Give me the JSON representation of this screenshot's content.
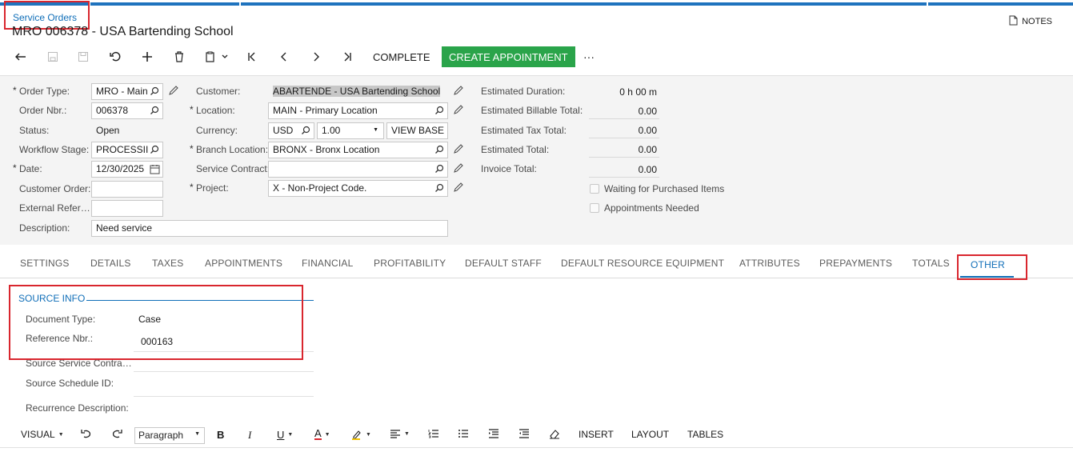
{
  "breadcrumb": "Service Orders",
  "title": "MRO 006378 - USA Bartending School",
  "notes_label": "NOTES",
  "toolbar": {
    "complete_label": "COMPLETE",
    "create_appointment_label": "CREATE APPOINTMENT",
    "more_label": "···"
  },
  "form": {
    "col1": {
      "order_type_label": "Order Type:",
      "order_type_value": "MRO - Main",
      "order_nbr_label": "Order Nbr.:",
      "order_nbr_value": "006378",
      "status_label": "Status:",
      "status_value": "Open",
      "workflow_stage_label": "Workflow Stage:",
      "workflow_stage_value": "PROCESSII",
      "date_label": "Date:",
      "date_value": "12/30/2025",
      "customer_order_label": "Customer Order:",
      "customer_order_value": "",
      "external_ref_label": "External Refer…",
      "external_ref_value": "",
      "description_label": "Description:",
      "description_value": "Need service"
    },
    "col2": {
      "customer_label": "Customer:",
      "customer_value": "ABARTENDE - USA Bartending School",
      "location_label": "Location:",
      "location_value": "MAIN - Primary Location",
      "currency_label": "Currency:",
      "currency_value": "USD",
      "rate_value": "1.00",
      "view_base_label": "VIEW BASE",
      "branch_location_label": "Branch Location:",
      "branch_location_value": "BRONX - Bronx Location",
      "service_contract_label": "Service Contract:",
      "service_contract_value": "",
      "project_label": "Project:",
      "project_value": "X - Non-Project Code."
    },
    "col3": {
      "est_duration_label": "Estimated Duration:",
      "est_duration_value": "0 h 00 m",
      "est_billable_label": "Estimated Billable Total:",
      "est_billable_value": "0.00",
      "est_tax_label": "Estimated Tax Total:",
      "est_tax_value": "0.00",
      "est_total_label": "Estimated Total:",
      "est_total_value": "0.00",
      "invoice_total_label": "Invoice Total:",
      "invoice_total_value": "0.00",
      "waiting_label": "Waiting for Purchased Items",
      "appointments_needed_label": "Appointments Needed"
    }
  },
  "tabs": [
    "SETTINGS",
    "DETAILS",
    "TAXES",
    "APPOINTMENTS",
    "FINANCIAL",
    "PROFITABILITY",
    "DEFAULT STAFF",
    "DEFAULT RESOURCE EQUIPMENT",
    "ATTRIBUTES",
    "PREPAYMENTS",
    "TOTALS",
    "OTHER"
  ],
  "active_tab": "OTHER",
  "source_info": {
    "title": "SOURCE INFO",
    "document_type_label": "Document Type:",
    "document_type_value": "Case",
    "reference_nbr_label": "Reference Nbr.:",
    "reference_nbr_value": "000163",
    "source_service_contract_label": "Source Service Contra…",
    "source_schedule_label": "Source Schedule ID:",
    "recurrence_label": "Recurrence Description:"
  },
  "editor": {
    "visual_label": "VISUAL",
    "paragraph_value": "Paragraph",
    "insert_label": "INSERT",
    "layout_label": "LAYOUT",
    "tables_label": "TABLES"
  },
  "colors": {
    "accent": "#0f6eb8",
    "primary_button": "#2aa44a",
    "highlight": "#d9262e",
    "top_bar": "#1e73be"
  }
}
